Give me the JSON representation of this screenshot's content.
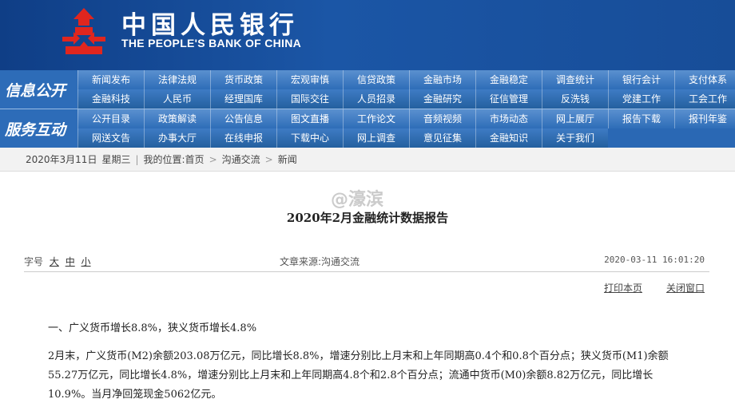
{
  "header": {
    "logo_cn": "中国人民银行",
    "logo_en": "THE PEOPLE'S BANK OF CHINA",
    "logo_color": "#e0261e"
  },
  "nav": {
    "band1": "信息公开",
    "band2": "服务互动",
    "rows": [
      [
        "新闻发布",
        "法律法规",
        "货币政策",
        "宏观审慎",
        "信贷政策",
        "金融市场",
        "金融稳定",
        "调查统计",
        "银行会计",
        "支付体系"
      ],
      [
        "金融科技",
        "人民币",
        "经理国库",
        "国际交往",
        "人员招录",
        "金融研究",
        "征信管理",
        "反洗钱",
        "党建工作",
        "工会工作"
      ],
      [
        "公开目录",
        "政策解读",
        "公告信息",
        "图文直播",
        "工作论文",
        "音频视频",
        "市场动态",
        "网上展厅",
        "报告下载",
        "报刊年鉴"
      ],
      [
        "网送文告",
        "办事大厅",
        "在线申报",
        "下载中心",
        "网上调查",
        "意见征集",
        "金融知识",
        "关于我们"
      ]
    ]
  },
  "breadcrumb": {
    "date": "2020年3月11日",
    "weekday": "星期三",
    "location_label": "我的位置:首页",
    "path1": "沟通交流",
    "path2": "新闻",
    "separator": ">"
  },
  "watermark": "@濠滨",
  "article": {
    "title": "2020年2月金融统计数据报告",
    "font_size_label": "字号",
    "font_large": "大",
    "font_medium": "中",
    "font_small": "小",
    "source": "文章来源:沟通交流",
    "timestamp": "2020-03-11  16:01:20",
    "print_link": "打印本页",
    "close_link": "关闭窗口",
    "heading1": "一、广义货币增长8.8%，狭义货币增长4.8%",
    "para1": "2月末，广义货币(M2)余额203.08万亿元，同比增长8.8%，增速分别比上月末和上年同期高0.4个和0.8个百分点；狭义货币(M1)余额55.27万亿元，同比增长4.8%，增速分别比上月末和上年同期高4.8个和2.8个百分点；流通中货币(M0)余额8.82万亿元，同比增长10.9%。当月净回笼现金5062亿元。"
  }
}
